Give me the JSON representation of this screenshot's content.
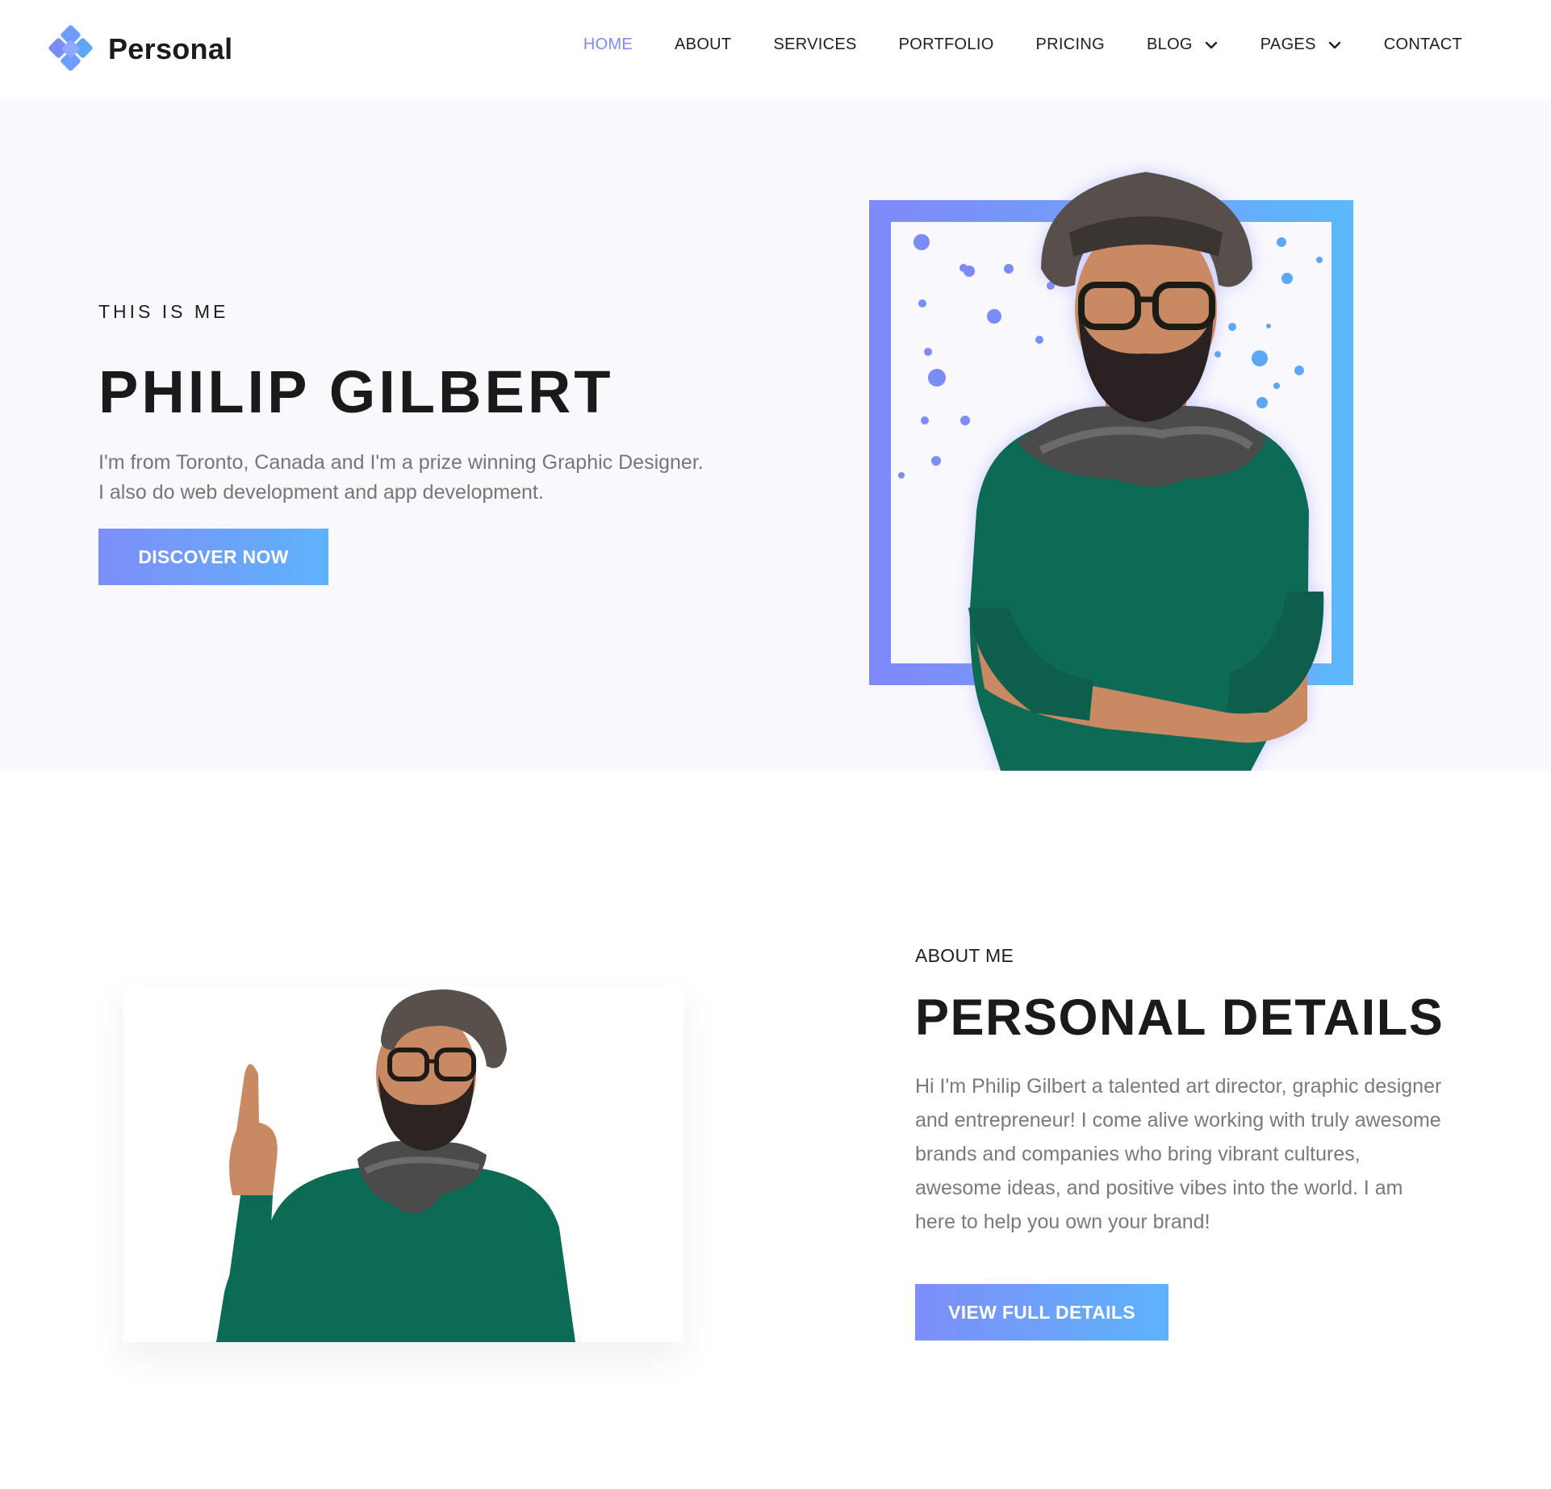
{
  "brand": {
    "name": "Personal"
  },
  "nav": {
    "items": [
      {
        "label": "HOME",
        "active": true,
        "dropdown": false
      },
      {
        "label": "ABOUT",
        "active": false,
        "dropdown": false
      },
      {
        "label": "SERVICES",
        "active": false,
        "dropdown": false
      },
      {
        "label": "PORTFOLIO",
        "active": false,
        "dropdown": false
      },
      {
        "label": "PRICING",
        "active": false,
        "dropdown": false
      },
      {
        "label": "BLOG",
        "active": false,
        "dropdown": true
      },
      {
        "label": "PAGES",
        "active": false,
        "dropdown": true
      },
      {
        "label": "CONTACT",
        "active": false,
        "dropdown": false
      }
    ]
  },
  "hero": {
    "eyebrow": "THIS IS ME",
    "title": "PHILIP GILBERT",
    "description": "I'm from Toronto, Canada and I'm a prize winning Graphic Designer. I also do web development and app development.",
    "button_label": "DISCOVER NOW"
  },
  "about": {
    "eyebrow": "ABOUT ME",
    "title": "PERSONAL DETAILS",
    "description": "Hi I'm Philip Gilbert a talented art director, graphic designer and entrepreneur! I come alive working with truly awesome brands and companies who bring vibrant cultures, awesome ideas, and positive vibes into the world. I am here to help you own your brand!",
    "button_label": "VIEW FULL DETAILS"
  },
  "colors": {
    "accent": "#7b8cf8",
    "accent_gradient_end": "#5db3fa",
    "sweater": "#0b6b55",
    "hero_bg": "#f9f8fd"
  }
}
